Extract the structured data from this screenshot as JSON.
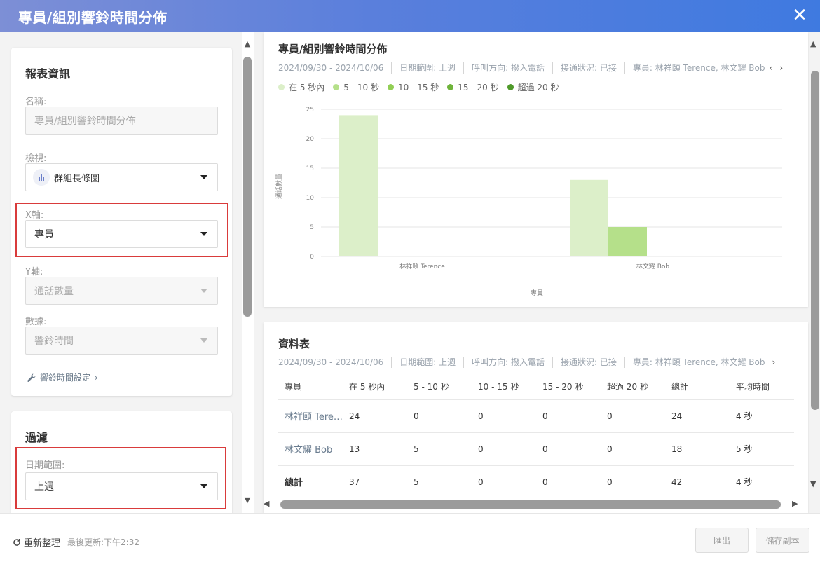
{
  "window": {
    "title": "專員/組別響鈴時間分佈",
    "close_glyph": "✕"
  },
  "report_info": {
    "title": "報表資訊",
    "name_label": "名稱:",
    "name_value": "專員/組別響鈴時間分佈",
    "view_label": "檢視:",
    "view_value": "群組長條圖",
    "xaxis_label": "X軸:",
    "xaxis_value": "專員",
    "yaxis_label": "Y軸:",
    "yaxis_value": "通話數量",
    "data_label": "數據:",
    "data_value": "響鈴時間",
    "ring_settings_link": "響鈴時間設定"
  },
  "filters": {
    "title": "過濾",
    "date_range_label": "日期範圍:",
    "date_range_value": "上週"
  },
  "footer": {
    "refresh_label": "重新整理",
    "last_updated": "最後更新:下午2:32",
    "export_label": "匯出",
    "save_copy_label": "儲存副本"
  },
  "chart_card": {
    "title": "專員/組別響鈴時間分佈",
    "meta": [
      "2024/09/30 - 2024/10/06",
      "日期範圍: 上週",
      "呼叫方向: 撥入電話",
      "接通狀況: 已接",
      "專員: 林祥頤 Terence, 林文耀 Bob"
    ]
  },
  "table_card": {
    "title": "資料表",
    "meta": [
      "2024/09/30 - 2024/10/06",
      "日期範圍: 上週",
      "呼叫方向: 撥入電話",
      "接通狀況: 已接",
      "專員: 林祥頤 Terence, 林文耀 Bob"
    ],
    "headers": [
      "專員",
      "在 5 秒內",
      "5 - 10 秒",
      "10 - 15 秒",
      "15 - 20 秒",
      "超過 20 秒",
      "總計",
      "平均時間"
    ],
    "rows": [
      [
        "林祥頤 Terence",
        "24",
        "0",
        "0",
        "0",
        "0",
        "24",
        "4 秒"
      ],
      [
        "林文耀 Bob",
        "13",
        "5",
        "0",
        "0",
        "0",
        "18",
        "5 秒"
      ]
    ],
    "total": [
      "總計",
      "37",
      "5",
      "0",
      "0",
      "0",
      "42",
      "4 秒"
    ]
  },
  "chart_data": {
    "type": "bar",
    "categories": [
      "林祥頤 Terence",
      "林文耀 Bob"
    ],
    "series": [
      {
        "name": "在 5 秒內",
        "color": "#dcefc9",
        "values": [
          24,
          13
        ]
      },
      {
        "name": "5 - 10 秒",
        "color": "#b5e08a",
        "values": [
          0,
          5
        ]
      },
      {
        "name": "10 - 15 秒",
        "color": "#92cf55",
        "values": [
          0,
          0
        ]
      },
      {
        "name": "15 - 20 秒",
        "color": "#6fb43b",
        "values": [
          0,
          0
        ]
      },
      {
        "name": "超過 20 秒",
        "color": "#4f9a2a",
        "values": [
          0,
          0
        ]
      }
    ],
    "xlabel": "專員",
    "ylabel": "通話數量",
    "ylim": [
      0,
      25
    ],
    "yticks": [
      0,
      5,
      10,
      15,
      20,
      25
    ],
    "grid": true,
    "legend": "top-left"
  }
}
